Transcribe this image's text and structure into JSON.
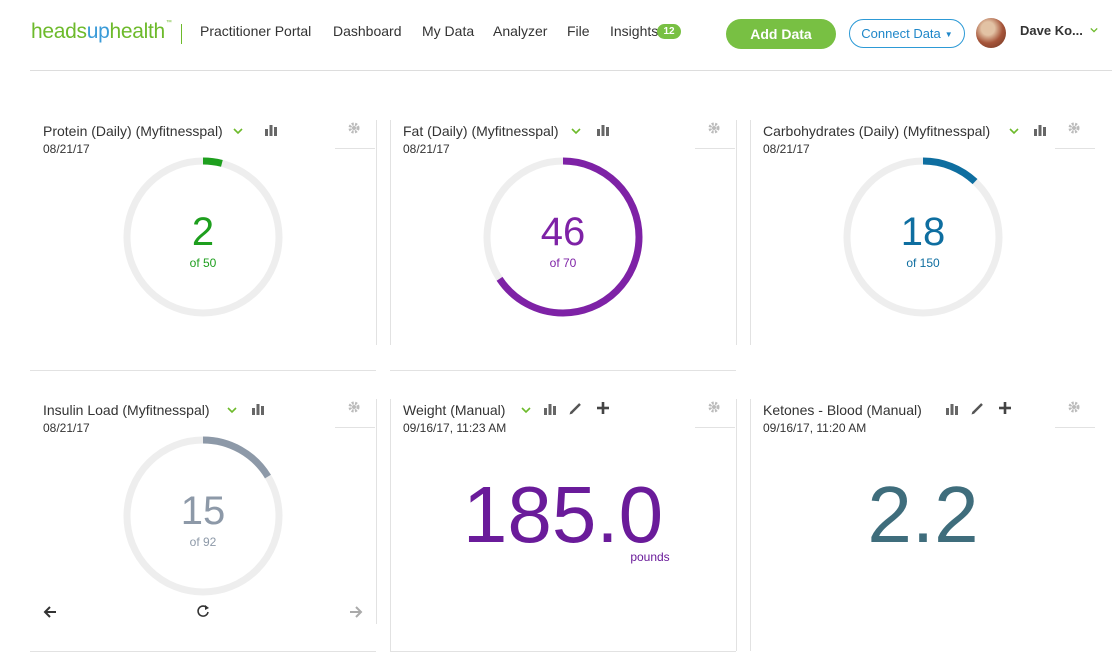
{
  "brand": {
    "part1": "heads",
    "part2": "up",
    "part3": "health",
    "tm": "™"
  },
  "nav": [
    {
      "label": "Practitioner Portal"
    },
    {
      "label": "Dashboard"
    },
    {
      "label": "My Data"
    },
    {
      "label": "Analyzer"
    },
    {
      "label": "File"
    },
    {
      "label": "Insights"
    }
  ],
  "insights_badge": "12",
  "add_data_label": "Add Data",
  "connect_data_label": "Connect Data",
  "user": {
    "name": "Dave Ko..."
  },
  "colors": {
    "green": "#78c043",
    "purple": "#7b1fa2",
    "blue": "#0e6ea0",
    "slate": "#8a95a5",
    "teal": "#3f6d7c",
    "track": "#eeeeee"
  },
  "cards": [
    {
      "title": "Protein (Daily) (Myfitnesspal)",
      "date": "08/21/17",
      "value": "2",
      "of": "of 50",
      "fraction": 0.04,
      "color": "#1e9f1e"
    },
    {
      "title": "Fat (Daily) (Myfitnesspal)",
      "date": "08/21/17",
      "value": "46",
      "of": "of 70",
      "fraction": 0.657,
      "color": "#7e22a6"
    },
    {
      "title": "Carbohydrates (Daily) (Myfitnesspal)",
      "date": "08/21/17",
      "value": "18",
      "of": "of 150",
      "fraction": 0.12,
      "color": "#0e6ea0"
    },
    {
      "title": "Insulin Load (Myfitnesspal)",
      "date": "08/21/17",
      "value": "15",
      "of": "of 92",
      "fraction": 0.163,
      "color": "#8d99a8"
    },
    {
      "title": "Weight (Manual)",
      "date": "09/16/17, 11:23 AM",
      "value": "185.0",
      "unit": "pounds",
      "color": "#6a1b9a"
    },
    {
      "title": "Ketones - Blood (Manual)",
      "date": "09/16/17, 11:20 AM",
      "value": "2.2",
      "color": "#3f6d7c"
    }
  ],
  "icons": [
    "chart-bar-icon",
    "chevron-down-icon",
    "gear-icon",
    "pencil-icon",
    "plus-icon",
    "arrow-left-icon",
    "refresh-icon",
    "arrow-right-icon"
  ]
}
